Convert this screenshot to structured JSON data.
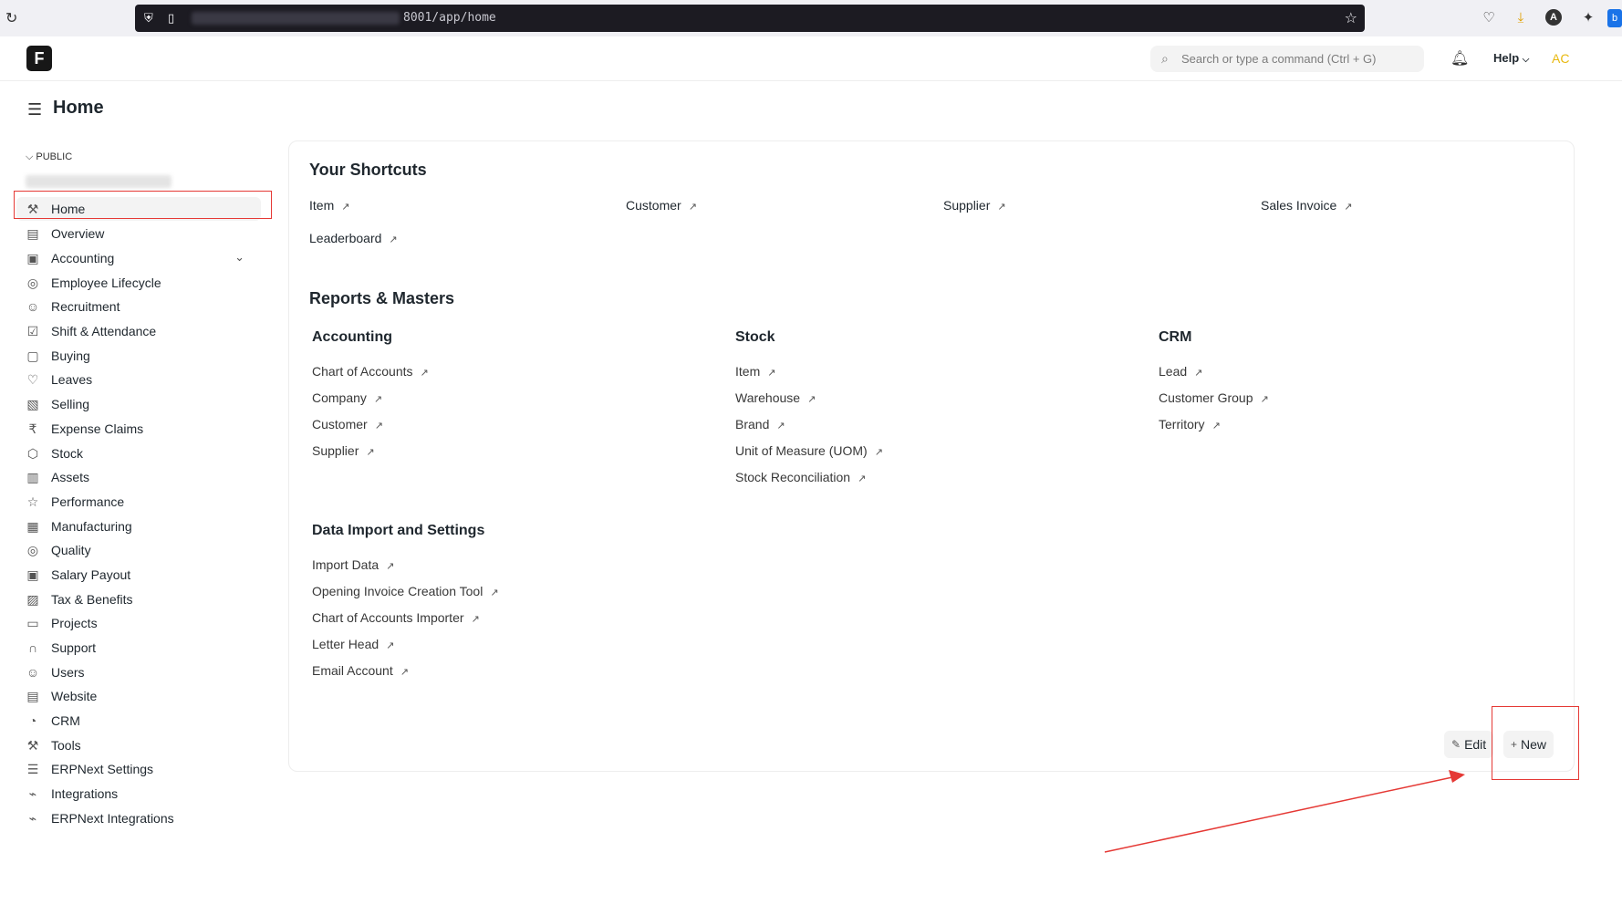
{
  "browser": {
    "url_suffix": "8001/app/home"
  },
  "navbar": {
    "search_placeholder": "Search or type a command (Ctrl + G)",
    "help_label": "Help",
    "user_initials": "AC"
  },
  "page": {
    "title": "Home"
  },
  "sidebar": {
    "section_label": "PUBLIC",
    "items": [
      {
        "label": "Home",
        "icon": "tools-icon"
      },
      {
        "label": "Overview",
        "icon": "box-icon"
      },
      {
        "label": "Accounting",
        "icon": "money-icon"
      },
      {
        "label": "Employee Lifecycle",
        "icon": "user-circle-icon"
      },
      {
        "label": "Recruitment",
        "icon": "users-icon"
      },
      {
        "label": "Shift & Attendance",
        "icon": "checklist-icon"
      },
      {
        "label": "Buying",
        "icon": "bag-icon"
      },
      {
        "label": "Leaves",
        "icon": "heart-icon"
      },
      {
        "label": "Selling",
        "icon": "tag-icon"
      },
      {
        "label": "Expense Claims",
        "icon": "rupee-icon"
      },
      {
        "label": "Stock",
        "icon": "package-icon"
      },
      {
        "label": "Assets",
        "icon": "archive-icon"
      },
      {
        "label": "Performance",
        "icon": "star-icon"
      },
      {
        "label": "Manufacturing",
        "icon": "factory-icon"
      },
      {
        "label": "Quality",
        "icon": "shield-check-icon"
      },
      {
        "label": "Salary Payout",
        "icon": "wallet-icon"
      },
      {
        "label": "Tax & Benefits",
        "icon": "calculator-icon"
      },
      {
        "label": "Projects",
        "icon": "folder-icon"
      },
      {
        "label": "Support",
        "icon": "headset-icon"
      },
      {
        "label": "Users",
        "icon": "users-icon"
      },
      {
        "label": "Website",
        "icon": "browser-icon"
      },
      {
        "label": "CRM",
        "icon": "pie-icon"
      },
      {
        "label": "Tools",
        "icon": "tools-icon"
      },
      {
        "label": "ERPNext Settings",
        "icon": "settings-icon"
      },
      {
        "label": "Integrations",
        "icon": "plug-icon"
      },
      {
        "label": "ERPNext Integrations",
        "icon": "plug-icon"
      }
    ]
  },
  "shortcuts": {
    "title": "Your Shortcuts",
    "items": [
      "Item",
      "Customer",
      "Supplier",
      "Sales Invoice",
      "Leaderboard"
    ]
  },
  "reports": {
    "title": "Reports & Masters",
    "groups": [
      {
        "title": "Accounting",
        "links": [
          "Chart of Accounts",
          "Company",
          "Customer",
          "Supplier"
        ]
      },
      {
        "title": "Stock",
        "links": [
          "Item",
          "Warehouse",
          "Brand",
          "Unit of Measure (UOM)",
          "Stock Reconciliation"
        ]
      },
      {
        "title": "CRM",
        "links": [
          "Lead",
          "Customer Group",
          "Territory"
        ]
      },
      {
        "title": "Data Import and Settings",
        "links": [
          "Import Data",
          "Opening Invoice Creation Tool",
          "Chart of Accounts Importer",
          "Letter Head",
          "Email Account"
        ]
      }
    ]
  },
  "actions": {
    "edit_label": "Edit",
    "new_label": "New"
  }
}
